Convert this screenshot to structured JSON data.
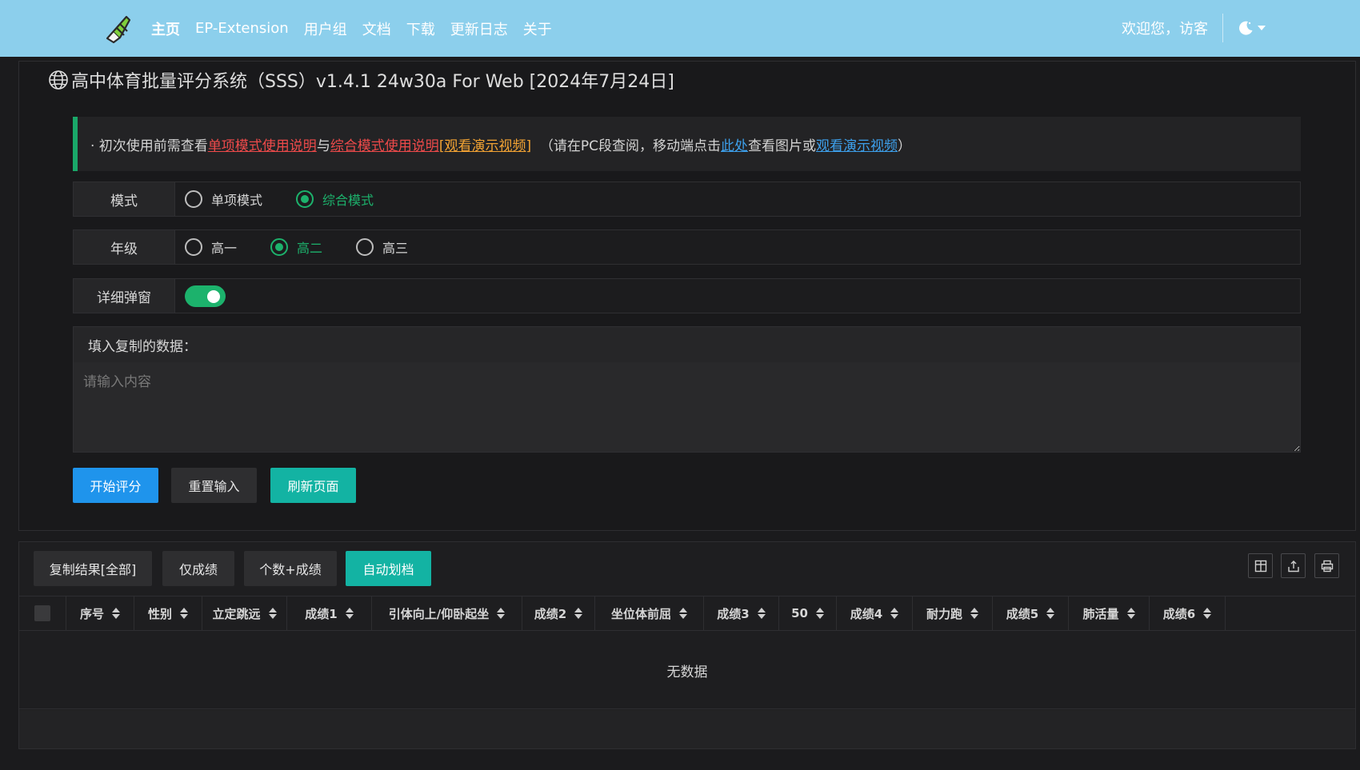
{
  "nav": {
    "items": [
      {
        "label": "主页"
      },
      {
        "label": "EP-Extension"
      },
      {
        "label": "用户组"
      },
      {
        "label": "文档"
      },
      {
        "label": "下载"
      },
      {
        "label": "更新日志"
      },
      {
        "label": "关于"
      }
    ],
    "welcome": "欢迎您，访客"
  },
  "page": {
    "title": "高中体育批量评分系统（SSS）v1.4.1 24w30a For Web [2024年7月24日]"
  },
  "notice": {
    "prefix": "· 初次使用前需查看",
    "link_single": " 单项模式使用说明",
    "and": "与",
    "link_combined": " 综合模式使用说明",
    "link_video": " [观看演示视频]",
    "middle": "  （请在PC段查阅，移动端点击",
    "link_here": "此处",
    "after_here": "查看图片或",
    "link_video2": "观看演示视频",
    "suffix": "）"
  },
  "form": {
    "mode": {
      "label": "模式",
      "options": [
        "单项模式",
        "综合模式"
      ],
      "selected": "综合模式"
    },
    "grade": {
      "label": "年级",
      "options": [
        "高一",
        "高二",
        "高三"
      ],
      "selected": "高二"
    },
    "popup": {
      "label": "详细弹窗",
      "enabled": true
    },
    "data": {
      "label": "填入复制的数据：",
      "placeholder": "请输入内容",
      "value": ""
    }
  },
  "actions": {
    "start": "开始评分",
    "reset": "重置输入",
    "refresh": "刷新页面"
  },
  "table": {
    "toolbar": [
      "复制结果[全部]",
      "仅成绩",
      "个数+成绩",
      "自动划档"
    ],
    "active_tool": "自动划档",
    "columns": [
      "序号",
      "性别",
      "立定跳远",
      "成绩1",
      "引体向上/仰卧起坐",
      "成绩2",
      "坐位体前屈",
      "成绩3",
      "50",
      "成绩4",
      "耐力跑",
      "成绩5",
      "肺活量",
      "成绩6"
    ],
    "empty_text": "无数据",
    "icons": [
      "columns-icon",
      "export-icon",
      "print-icon"
    ]
  },
  "colors": {
    "nav_bg": "#8ccfec",
    "accent_green": "#1cb26c",
    "primary_blue": "#1f94ec",
    "teal": "#13b3a3"
  }
}
